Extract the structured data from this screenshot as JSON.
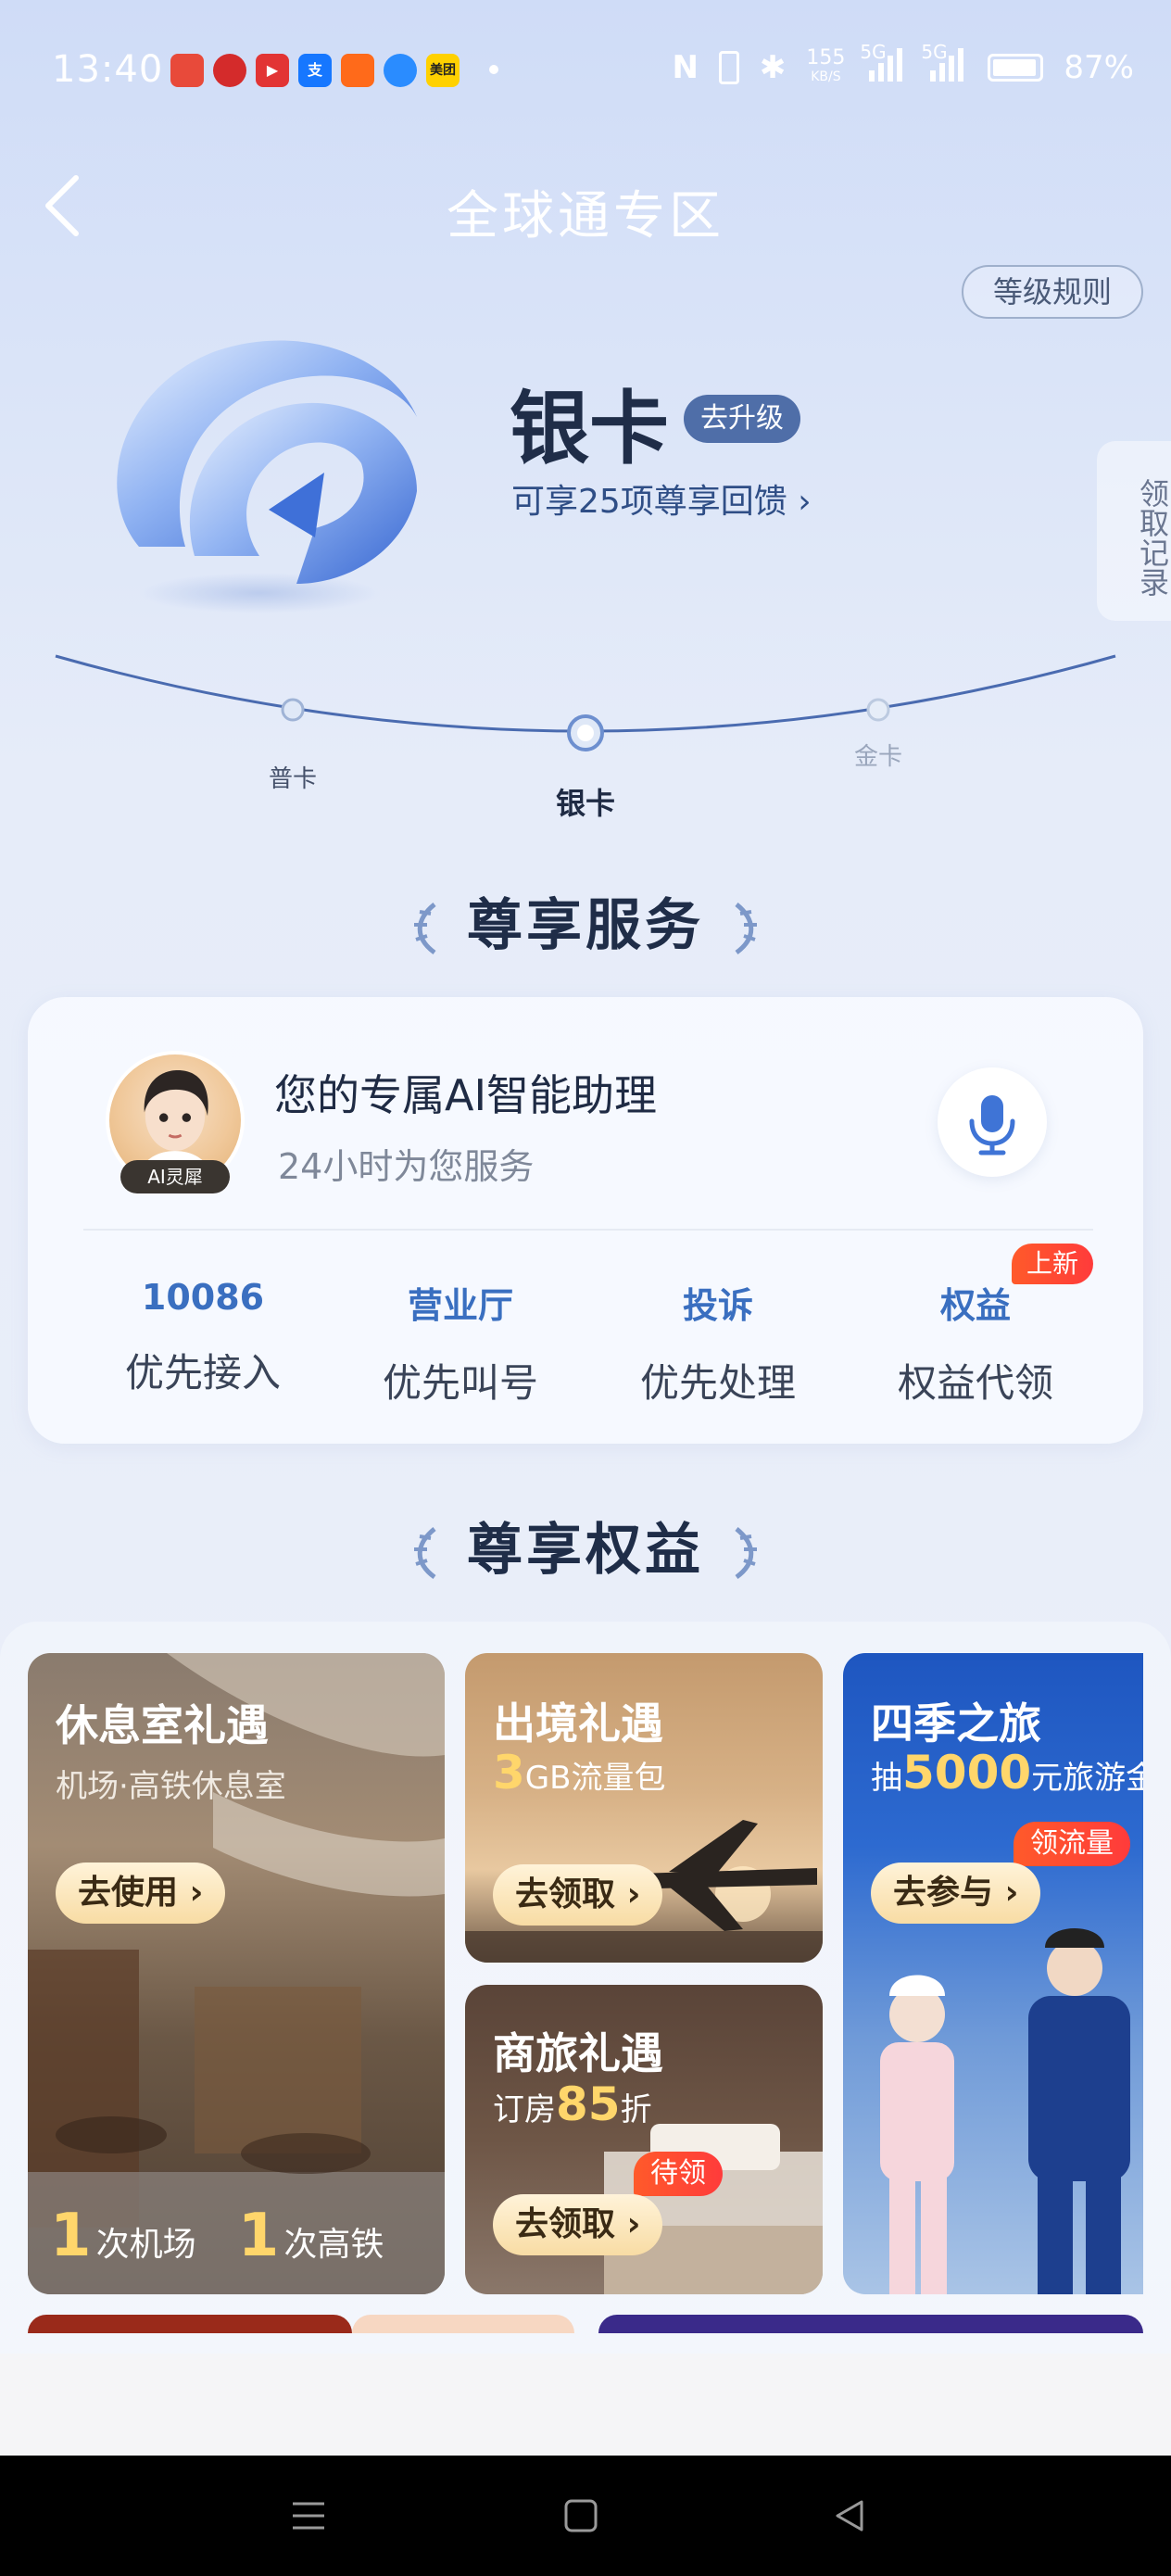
{
  "status_bar": {
    "time": "13:40",
    "network_speed": "155",
    "network_unit": "KB/S",
    "signal1": "5G",
    "signal2": "5G",
    "battery": "87%"
  },
  "header": {
    "title": "全球通专区",
    "rules_label": "等级规则",
    "side_tab": "领取记录"
  },
  "level_card": {
    "level_name": "银卡",
    "upgrade_label": "去升级",
    "benefit_text": "可享25项尊享回馈",
    "levels": [
      "普卡",
      "银卡",
      "金卡"
    ]
  },
  "services": {
    "section_title": "尊享服务",
    "assistant_title": "您的专属AI智能助理",
    "assistant_sub": "24小时为您服务",
    "avatar_tag": "AI灵犀",
    "items": [
      {
        "top": "10086",
        "bottom": "优先接入"
      },
      {
        "top": "营业厅",
        "bottom": "优先叫号"
      },
      {
        "top": "投诉",
        "bottom": "优先处理"
      },
      {
        "top": "权益",
        "bottom": "权益代领"
      }
    ],
    "new_badge": "上新"
  },
  "benefits": {
    "section_title": "尊享权益",
    "lounge": {
      "title": "休息室礼遇",
      "sub": "机场·高铁休息室",
      "button": "去使用",
      "count1": "1",
      "unit1": "次机场",
      "count2": "1",
      "unit2": "次高铁"
    },
    "outbound": {
      "title": "出境礼遇",
      "hl": "3",
      "sub": "GB流量包",
      "button": "去领取"
    },
    "business": {
      "title": "商旅礼遇",
      "sub_pre": "订房",
      "hl": "85",
      "sub_post": "折",
      "button": "去领取",
      "tag": "待领"
    },
    "travel": {
      "title": "四季之旅",
      "sub_pre": "抽",
      "hl": "5000",
      "sub_post": "元旅游金",
      "button": "去参与",
      "tag": "领流量"
    }
  },
  "colors": {
    "accent": "#3a6fc0",
    "badge": "#ff4a2e",
    "title_dark": "#1f2d48"
  }
}
